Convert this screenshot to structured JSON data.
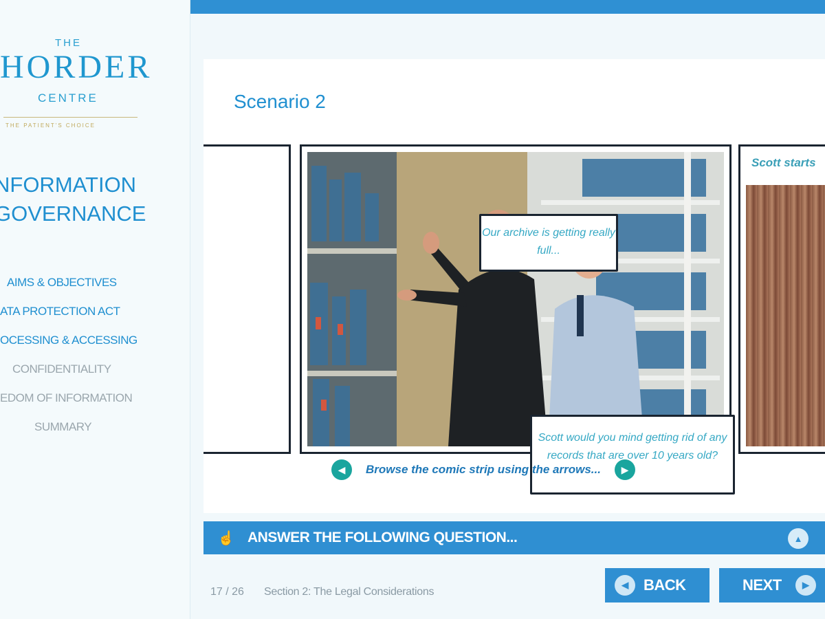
{
  "logo": {
    "the": "THE",
    "name": "HORDER",
    "centre": "CENTRE",
    "tagline": "THE PATIENT'S CHOICE"
  },
  "sidebar": {
    "module_title_line1": "NFORMATION",
    "module_title_line2": "GOVERNANCE",
    "menu": [
      {
        "label": "AIMS & OBJECTIVES",
        "state": "done"
      },
      {
        "label": "ATA PROTECTION ACT",
        "state": "done"
      },
      {
        "label": "OCESSING & ACCESSING",
        "state": "done"
      },
      {
        "label": "CONFIDENTIALITY",
        "state": "todo"
      },
      {
        "label": "EDOM OF INFORMATION",
        "state": "todo"
      },
      {
        "label": "SUMMARY",
        "state": "todo"
      }
    ]
  },
  "main": {
    "scenario_title": "Scenario 2",
    "comic": {
      "bubble_1": "Our archive is getting really full...",
      "bubble_2": "Scott would you mind getting rid of any records that are over 10 years old?",
      "next_caption": "Scott starts",
      "hint": "Browse the comic strip using the arrows..."
    }
  },
  "question_bar": {
    "label": "ANSWER THE FOLLOWING QUESTION..."
  },
  "footer": {
    "page_current": 17,
    "page_total": 26,
    "page_count_text": "17 / 26",
    "section": "Section 2: The Legal Considerations",
    "back_label": "BACK",
    "next_label": "NEXT"
  },
  "icons": {
    "prev_arrow": "chevron-left-icon",
    "next_arrow": "chevron-right-icon",
    "hand": "pointer-hand-icon",
    "collapse": "chevron-up-icon"
  },
  "colors": {
    "accent_blue": "#2f8fd2",
    "title_blue": "#1f8fd0",
    "teal": "#1aa59e",
    "inactive_grey": "#9aa6ad"
  }
}
